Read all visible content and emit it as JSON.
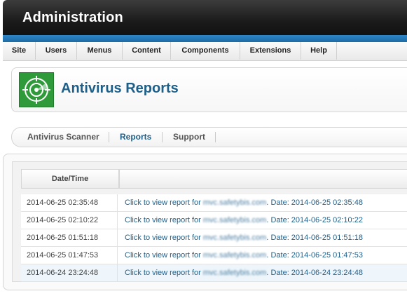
{
  "header": {
    "title": "Administration"
  },
  "menu": [
    "Site",
    "Users",
    "Menus",
    "Content",
    "Components",
    "Extensions",
    "Help"
  ],
  "page": {
    "title": "Antivirus Reports"
  },
  "tabs": [
    {
      "label": "Antivirus Scanner",
      "active": false
    },
    {
      "label": "Reports",
      "active": true
    },
    {
      "label": "Support",
      "active": false
    }
  ],
  "table": {
    "column_header": "Date/Time",
    "rows": [
      {
        "datetime": "2014-06-25 02:35:48",
        "link_prefix": "Click to view report for",
        "site": "mvc.safetybis.com",
        "link_suffix": ". Date: 2014-06-25 02:35:48"
      },
      {
        "datetime": "2014-06-25 02:10:22",
        "link_prefix": "Click to view report for",
        "site": "mvc.safetybis.com",
        "link_suffix": ". Date: 2014-06-25 02:10:22"
      },
      {
        "datetime": "2014-06-25 01:51:18",
        "link_prefix": "Click to view report for",
        "site": "mvc.safetybis.com",
        "link_suffix": ". Date: 2014-06-25 01:51:18"
      },
      {
        "datetime": "2014-06-25 01:47:53",
        "link_prefix": "Click to view report for",
        "site": "mvc.safetybis.com",
        "link_suffix": ". Date: 2014-06-25 01:47:53"
      },
      {
        "datetime": "2014-06-24 23:24:48",
        "link_prefix": "Click to view report for",
        "site": "mvc.safetybis.com",
        "link_suffix": ". Date: 2014-06-24 23:24:48"
      }
    ]
  },
  "colors": {
    "accent": "#1e5f8a",
    "header_bg": "#1a1a1a",
    "strip": "#2376b8",
    "logo_bg": "#2f9a3a"
  },
  "icons": {
    "logo": "radar-target-icon"
  }
}
